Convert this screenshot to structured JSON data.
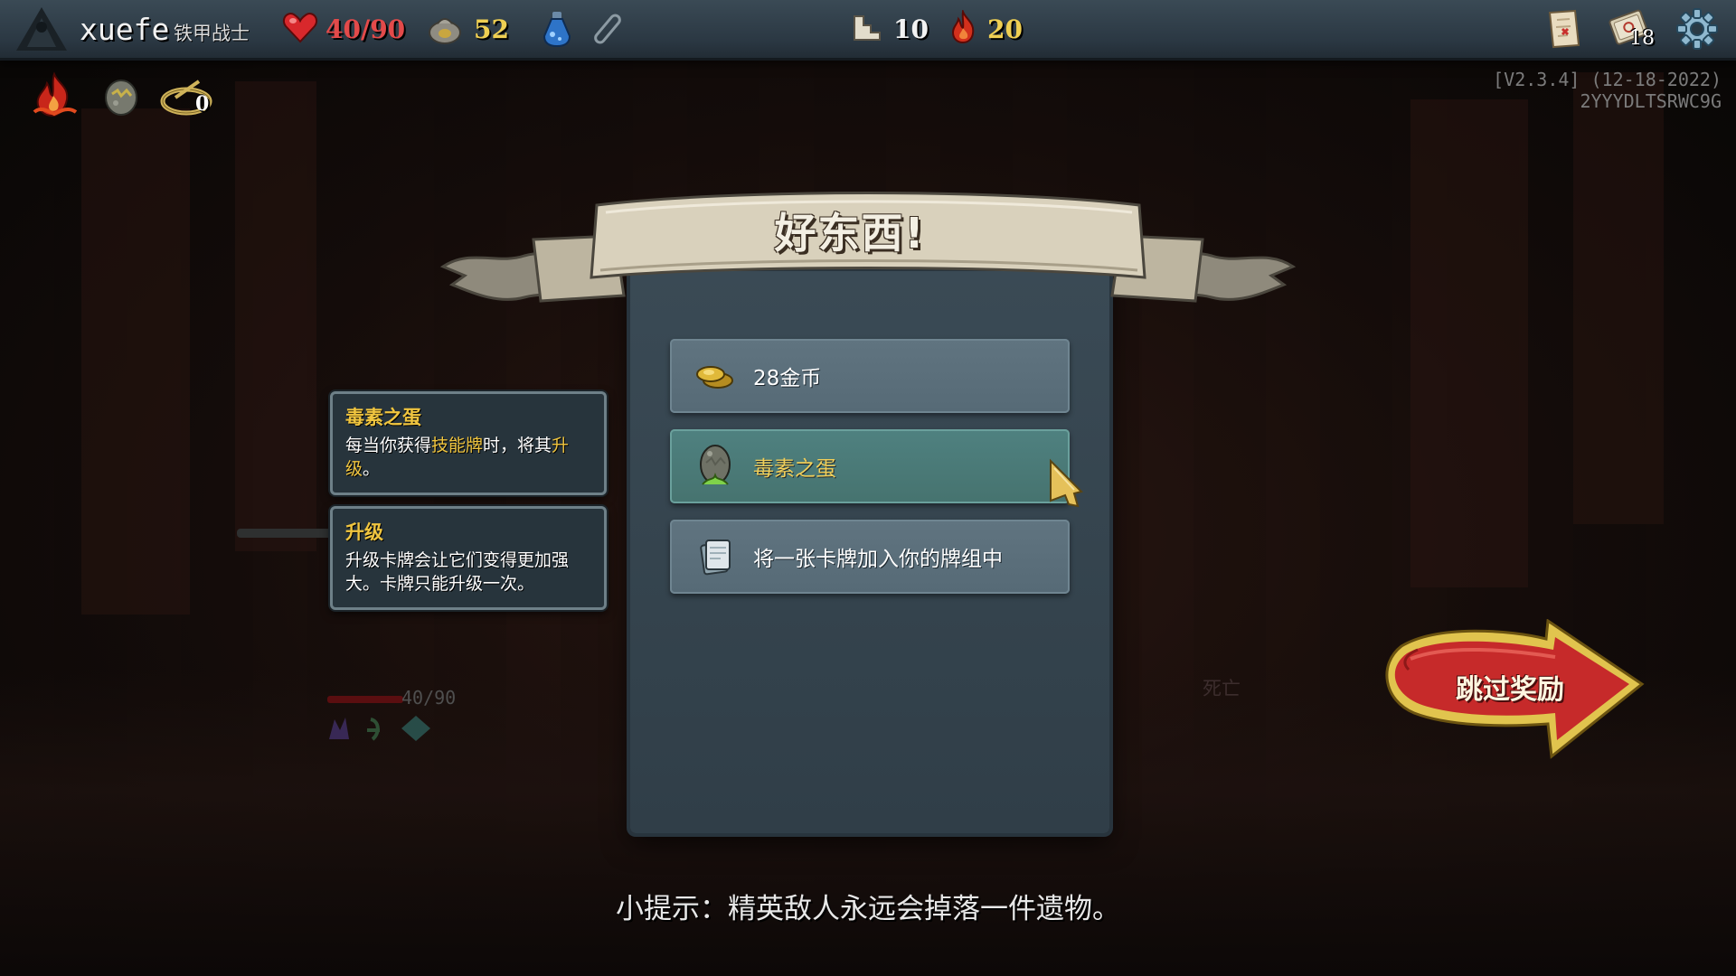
{
  "top_bar": {
    "player_name": "xuefe",
    "player_class": "铁甲战士",
    "hp": "40/90",
    "gold": "52",
    "floor": "10",
    "ascension": "20",
    "deck_count": "18",
    "icons": [
      "character-silhouette-icon",
      "heart-icon",
      "gold-pouch-icon",
      "blue-potion-icon",
      "empty-potion-slot-icon",
      "floor-stairs-icon",
      "ascension-flame-icon",
      "map-icon",
      "deck-icon",
      "settings-gear-icon"
    ]
  },
  "relics": {
    "items": [
      "burning-blood-icon",
      "toxic-egg-relic-icon",
      "juzu-bracelet-icon"
    ],
    "counter": "0"
  },
  "version": {
    "line1": "[V2.3.4] (12-18-2022)",
    "line2": "2YYYDLTSRWC9G"
  },
  "banner": {
    "title": "好东西!"
  },
  "rewards": [
    {
      "icon": "gold-coins-icon",
      "label": "28金币",
      "selected": false
    },
    {
      "icon": "toxic-egg-icon",
      "label": "毒素之蛋",
      "selected": true
    },
    {
      "icon": "card-icon",
      "label": "将一张卡牌加入你的牌组中",
      "selected": false
    }
  ],
  "tooltips": [
    {
      "title": "毒素之蛋",
      "body_parts": [
        "每当你获得",
        "技能牌",
        "时，将其",
        "升级",
        "。"
      ]
    },
    {
      "title": "升级",
      "body": "升级卡牌会让它们变得更加强大。卡牌只能升级一次。"
    }
  ],
  "skip_button": {
    "label": "跳过奖励"
  },
  "hint": "小提示：精英敌人永远会掉落一件遗物。",
  "faded": {
    "hp": "40/90",
    "dead_label": "死亡"
  },
  "colors": {
    "accent_gold": "#f0c53f",
    "hp_red": "#e34a4a",
    "gold_yellow": "#efcf52",
    "panel_slate": "#3a4a55",
    "selected_teal": "#4f8180",
    "skip_red": "#c62a2a"
  }
}
